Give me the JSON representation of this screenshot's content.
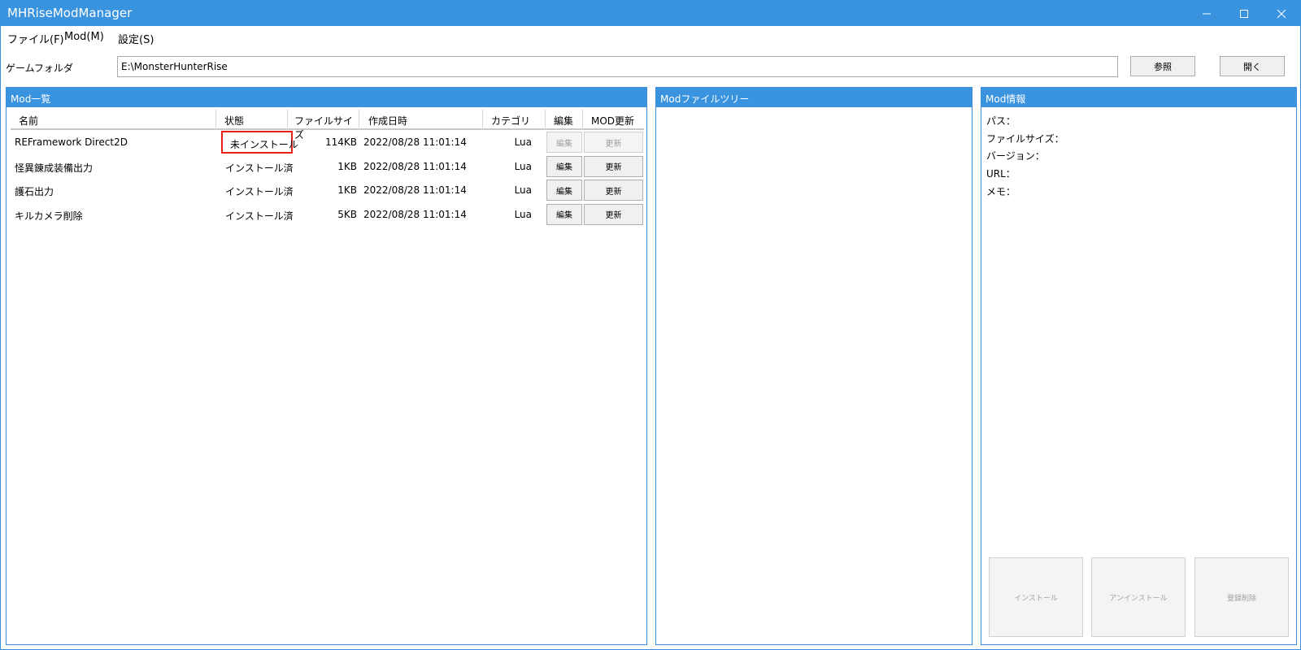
{
  "window": {
    "title": "MHRiseModManager"
  },
  "menu": [
    {
      "label": "ファイル(F)"
    },
    {
      "label": "Mod(M)"
    },
    {
      "label": "設定(S)"
    }
  ],
  "folder": {
    "label": "ゲームフォルダ",
    "value": "E:\\MonsterHunterRise",
    "browse_label": "参照",
    "open_label": "開く"
  },
  "mod_list": {
    "title": "Mod一覧",
    "columns": [
      "名前",
      "状態",
      "ファイルサイズ",
      "作成日時",
      "カテゴリ",
      "編集",
      "MOD更新"
    ],
    "rows": [
      {
        "name": "REFramework Direct2D",
        "status": "未インストール",
        "size": "114KB",
        "date": "2022/08/28 11:01:14",
        "category": "Lua",
        "edit": "編集",
        "update": "更新",
        "disabled": true,
        "highlight": true
      },
      {
        "name": "怪異錬成装備出力",
        "status": "インストール済",
        "size": "1KB",
        "date": "2022/08/28 11:01:14",
        "category": "Lua",
        "edit": "編集",
        "update": "更新",
        "disabled": false,
        "highlight": false
      },
      {
        "name": "護石出力",
        "status": "インストール済",
        "size": "1KB",
        "date": "2022/08/28 11:01:14",
        "category": "Lua",
        "edit": "編集",
        "update": "更新",
        "disabled": false,
        "highlight": false
      },
      {
        "name": "キルカメラ削除",
        "status": "インストール済",
        "size": "5KB",
        "date": "2022/08/28 11:01:14",
        "category": "Lua",
        "edit": "編集",
        "update": "更新",
        "disabled": false,
        "highlight": false
      }
    ]
  },
  "file_tree": {
    "title": "Modファイルツリー"
  },
  "mod_info": {
    "title": "Mod情報",
    "path_label": "パス：",
    "size_label": "ファイルサイズ：",
    "version_label": "バージョン：",
    "url_label": "URL：",
    "memo_label": "メモ：",
    "install_label": "インストール",
    "uninstall_label": "アンインストール",
    "delete_label": "登録削除"
  },
  "colors": {
    "accent": "#3a93de",
    "highlight": "#e8201c"
  }
}
